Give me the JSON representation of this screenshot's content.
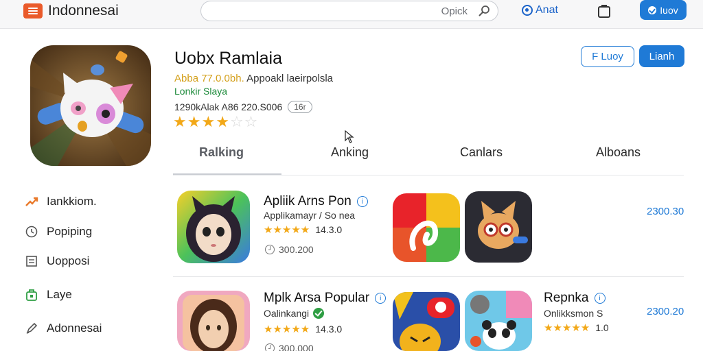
{
  "header": {
    "app_name": "Indonnesai",
    "search_text": "Opick",
    "account_label": "Anat",
    "action_label": "Iuov"
  },
  "hero": {
    "title": "Uobx Ramlaia",
    "price": "Abba 77.0.0bh.",
    "subtitle": "Appoakl laeirpolsla",
    "developer": "Lonkir Slaya",
    "meta": "1290kAlak A86 220.S006",
    "age_rating": "16r",
    "rating_stars": 3.5,
    "buttons": {
      "outline": "F Luoy",
      "primary": "Lianh"
    }
  },
  "tabs": [
    "Ralking",
    "Anking",
    "Canlars",
    "Alboans"
  ],
  "sidebar": [
    {
      "label": "Iankkiom.",
      "icon": "trend-icon"
    },
    {
      "label": "Popiping",
      "icon": "clock-icon"
    },
    {
      "label": "Uopposi",
      "icon": "document-icon"
    },
    {
      "label": "Laye",
      "icon": "shopping-bag-icon"
    },
    {
      "label": "Adonnesai",
      "icon": "pen-icon"
    }
  ],
  "list": [
    {
      "title": "Apliik Arns Pon",
      "subtitle": "Applikamayr / So nea",
      "stars": "★★★★★",
      "rating": "14.3.0",
      "size": "300.200",
      "price": "2300.30"
    },
    {
      "title": "Mplk Arsa Popular",
      "subtitle": "Oalinkangi",
      "stars": "★★★★★",
      "rating": "14.3.0",
      "size": "300.000",
      "price": ""
    },
    {
      "title": "Repnka",
      "subtitle": "Onlikksmon S",
      "stars": "★★★★★",
      "rating": "1.0",
      "size": "",
      "price": "2300.20"
    }
  ],
  "colors": {
    "accent": "#1f7ad6",
    "brand": "#ea5a2a",
    "star": "#f2a818",
    "developer": "#1c8a3a"
  }
}
